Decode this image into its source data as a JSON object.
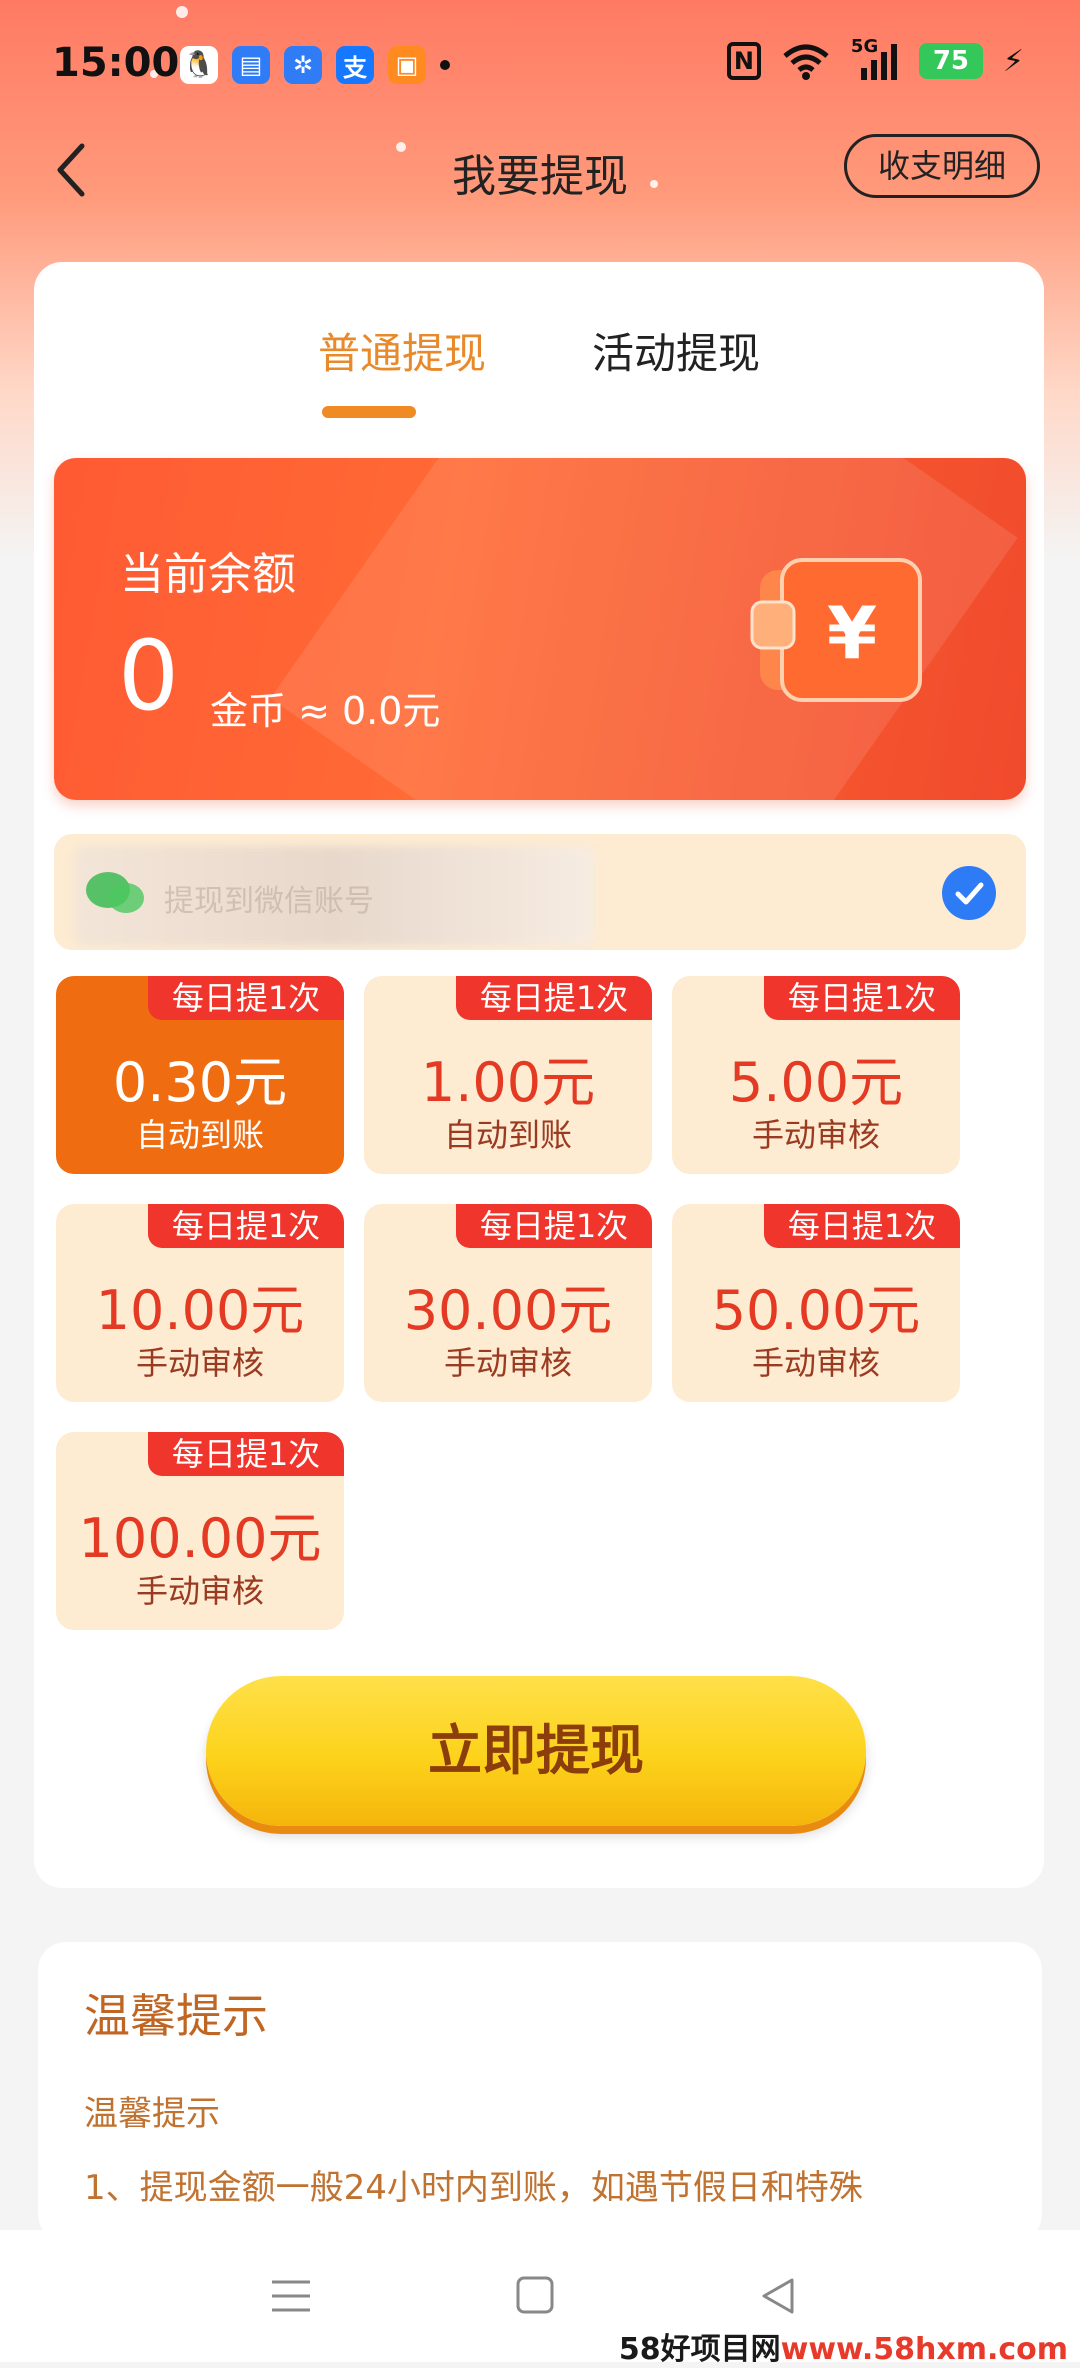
{
  "status_bar": {
    "time": "15:00",
    "apps": [
      {
        "icon": "qq-icon",
        "glyph": "🐧",
        "color": "#ffffff"
      },
      {
        "icon": "messages-icon",
        "glyph": "▤",
        "color": "#2f7cf6"
      },
      {
        "icon": "pinwheel-app-icon",
        "glyph": "✲",
        "color": "#2f7cf6"
      },
      {
        "icon": "alipay-icon",
        "glyph": "支",
        "color": "#1677ff"
      },
      {
        "icon": "taopiaopiao-icon",
        "glyph": "▣",
        "color": "#ff8a1f"
      }
    ],
    "battery": "75",
    "network": "5G"
  },
  "nav": {
    "title": "我要提现",
    "detail_button": "收支明细"
  },
  "tabs": {
    "normal": "普通提现",
    "activity": "活动提现"
  },
  "balance": {
    "label": "当前余额",
    "value": "0",
    "unit": "金币 ≈ 0.0元"
  },
  "account": {
    "label": "提现到微信账号"
  },
  "amounts": [
    {
      "tag": "每日提1次",
      "value": "0.30元",
      "note": "自动到账",
      "selected": true
    },
    {
      "tag": "每日提1次",
      "value": "1.00元",
      "note": "自动到账",
      "selected": false
    },
    {
      "tag": "每日提1次",
      "value": "5.00元",
      "note": "手动审核",
      "selected": false
    },
    {
      "tag": "每日提1次",
      "value": "10.00元",
      "note": "手动审核",
      "selected": false
    },
    {
      "tag": "每日提1次",
      "value": "30.00元",
      "note": "手动审核",
      "selected": false
    },
    {
      "tag": "每日提1次",
      "value": "50.00元",
      "note": "手动审核",
      "selected": false
    },
    {
      "tag": "每日提1次",
      "value": "100.00元",
      "note": "手动审核",
      "selected": false
    }
  ],
  "withdraw_button": "立即提现",
  "tips": {
    "title": "温馨提示",
    "subtitle": "温馨提示",
    "line1": "1、提现金额一般24小时内到账，如遇节假日和特殊"
  },
  "watermark": {
    "brand": "58好项目网",
    "url": "www.58hxm.com"
  },
  "colors": {
    "accent": "#f08a25",
    "selected_amount": "#ef6c10",
    "tag_red": "#f0352c",
    "button_yellow": "#fcd21a"
  }
}
